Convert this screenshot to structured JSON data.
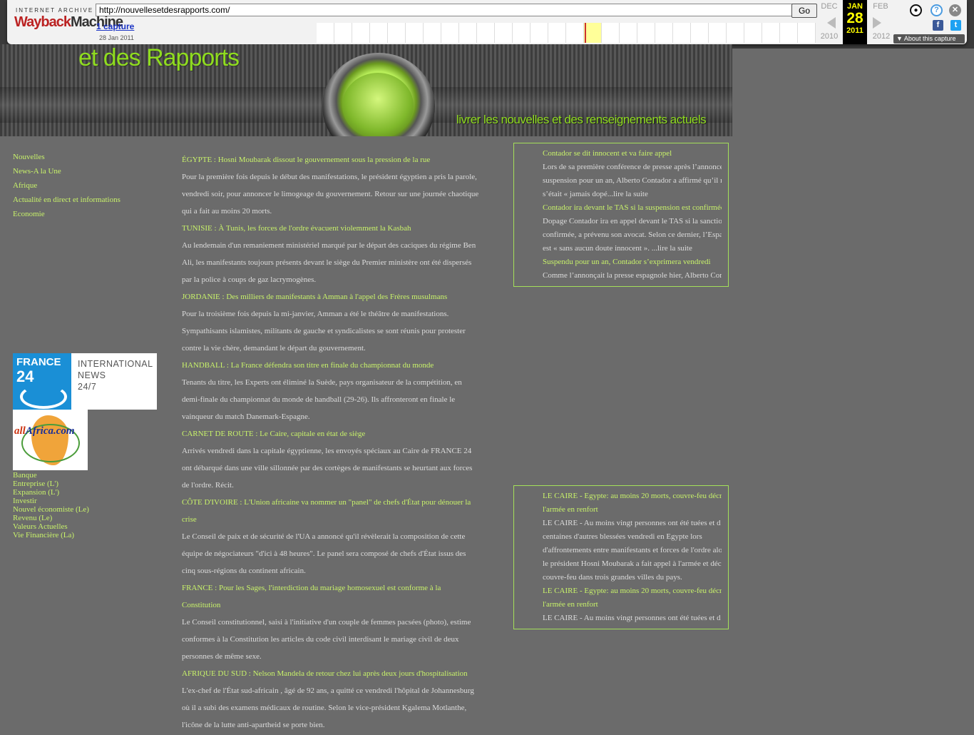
{
  "wayback": {
    "logo_top": "INTERNET ARCHIVE",
    "logo_main_a": "Wayback",
    "logo_main_b": "Machine",
    "url": "http://nouvellesetdesrapports.com/",
    "go_label": "Go",
    "captures_link": "1 capture",
    "capture_date": "28 Jan 2011",
    "prev_month": "DEC",
    "prev_year": "2010",
    "cur_month": "JAN",
    "cur_day": "28",
    "cur_year": "2011",
    "next_month": "FEB",
    "next_year": "2012",
    "about_label": "About this capture",
    "icons": [
      "user-icon",
      "help-icon",
      "close-icon",
      "facebook-icon",
      "twitter-icon"
    ]
  },
  "banner": {
    "title": "et des Rapports",
    "tagline": "livrer les nouvelles et des renseignements actuels",
    "accent_color": "#8fdc1f"
  },
  "nav": {
    "items": [
      "Nouvelles",
      "News-A la Une",
      "Afrique",
      "Actualité en direct et informations",
      "Economie"
    ]
  },
  "sponsors": {
    "france24_brand_a": "FRANCE",
    "france24_brand_b": "24",
    "france24_text": [
      "INTERNATIONAL",
      "NEWS",
      "24/7"
    ],
    "allafrica_a": "all",
    "allafrica_b": "Africa.com"
  },
  "bottom_links": [
    "Banque",
    "Entreprise (L')",
    "Expansion (L')",
    "Investir",
    "Nouvel économiste (Le)",
    "Revenu (Le)",
    "Valeurs Actuelles",
    "Vie Financière (La)"
  ],
  "articles": [
    {
      "headline": "ÉGYPTE : Hosni Moubarak dissout le gouvernement sous la pression de la rue",
      "body": "Pour la première fois depuis le début des manifestations, le président égyptien a pris la parole, vendredi soir, pour annoncer le limogeage du gouvernement. Retour sur une journée chaotique qui a fait au moins 20 morts."
    },
    {
      "headline": "TUNISIE : À Tunis, les forces de l'ordre évacuent violemment la Kasbah",
      "body": "Au lendemain d'un remaniement ministériel marqué par le départ des caciques du régime Ben Ali, les manifestants toujours présents devant le siège du Premier ministère ont été dispersés par la police à coups de gaz lacrymogènes."
    },
    {
      "headline": "JORDANIE : Des milliers de manifestants à Amman à l'appel des Frères musulmans",
      "body": "Pour la troisième fois depuis la mi-janvier, Amman a été le théâtre de manifestations. Sympathisants islamistes, militants de gauche et syndicalistes se sont réunis pour protester contre la vie chère, demandant le départ du gouvernement."
    },
    {
      "headline": "HANDBALL : La France défendra son titre en finale du championnat du monde",
      "body": "Tenants du titre, les Experts ont éliminé la Suède, pays organisateur de la compétition, en demi-finale du championnat du monde de handball (29-26). Ils affronteront en finale le vainqueur du match Danemark-Espagne."
    },
    {
      "headline": "CARNET DE ROUTE : Le Caire, capitale en état de siège",
      "body": "Arrivés vendredi dans la capitale égyptienne, les envoyés spéciaux au Caire de FRANCE 24 ont débarqué dans une ville sillonnée par des cortèges de manifestants se heurtant aux forces de l'ordre. Récit."
    },
    {
      "headline": "CÔTE D'IVOIRE : L'Union africaine va nommer un \"panel\" de chefs d'État pour dénouer la crise",
      "body": "Le Conseil de paix et de sécurité de l'UA a annoncé qu'il révèlerait la composition de cette équipe de négociateurs \"d'ici à 48 heures\". Le panel sera composé de chefs d'État issus des cinq sous-régions du continent africain."
    },
    {
      "headline": "FRANCE : Pour les Sages, l'interdiction du mariage homosexuel est conforme à la Constitution",
      "body": "Le Conseil constitutionnel, saisi à l'initiative d'un couple de femmes pacsées (photo), estime conformes à la Constitution les articles du code civil interdisant le mariage civil de deux personnes de même sexe."
    },
    {
      "headline": "AFRIQUE DU SUD : Nelson Mandela de retour chez lui après deux jours d'hospitalisation",
      "body": "L'ex-chef de l'État sud-africain , âgé de 92 ans, a quitté ce vendredi l'hôpital de Johannesburg où il a subi des examens médicaux de routine. Selon le vice-président Kgalema Motlanthe, l'icône de la lutte anti-apartheid se porte bien."
    }
  ],
  "rbox1": {
    "lines": [
      {
        "type": "h",
        "text": "Contador se dit innocent et va faire appel"
      },
      {
        "type": "b",
        "text": "Lors de sa première conférence de presse après l’annonce"
      },
      {
        "type": "b",
        "text": "suspension pour un an, Alberto Contador a affirmé qu’il n"
      },
      {
        "type": "b",
        "text": "s’était « jamais dopé...lire la suite"
      },
      {
        "type": "h",
        "text": "Contador ira devant le TAS si la suspension est confirmée"
      },
      {
        "type": "b",
        "text": "Dopage Contador ira en appel devant le TAS si la sanction"
      },
      {
        "type": "b",
        "text": "confirmée, a prévenu son avocat. Selon ce dernier, l’Espa"
      },
      {
        "type": "b",
        "text": "est « sans aucun doute innocent ». ...lire la suite"
      },
      {
        "type": "h",
        "text": "Suspendu pour un an, Contador s’exprimera vendredi"
      },
      {
        "type": "b",
        "text": "Comme l’annonçait la presse espagnole hier, Alberto Con"
      }
    ]
  },
  "rbox2": {
    "lines": [
      {
        "type": "h",
        "text": "LE CAIRE - Egypte: au moins 20 morts, couvre-feu décr"
      },
      {
        "type": "h",
        "text": "l'armée en renfort"
      },
      {
        "type": "b",
        "text": "LE CAIRE - Au moins vingt personnes ont été tuées et d"
      },
      {
        "type": "b",
        "text": "centaines d'autres blessées vendredi en Egypte lors"
      },
      {
        "type": "b",
        "text": "d'affrontements entre manifestants et forces de l'ordre alo"
      },
      {
        "type": "b",
        "text": "le président Hosni Moubarak a fait appel à l'armée et déc"
      },
      {
        "type": "b",
        "text": "couvre-feu dans trois grandes villes du pays."
      },
      {
        "type": "h",
        "text": "LE CAIRE - Egypte: au moins 20 morts, couvre-feu décr"
      },
      {
        "type": "h",
        "text": "l'armée en renfort"
      },
      {
        "type": "b",
        "text": "LE CAIRE - Au moins vingt personnes ont été tuées et d"
      }
    ]
  }
}
